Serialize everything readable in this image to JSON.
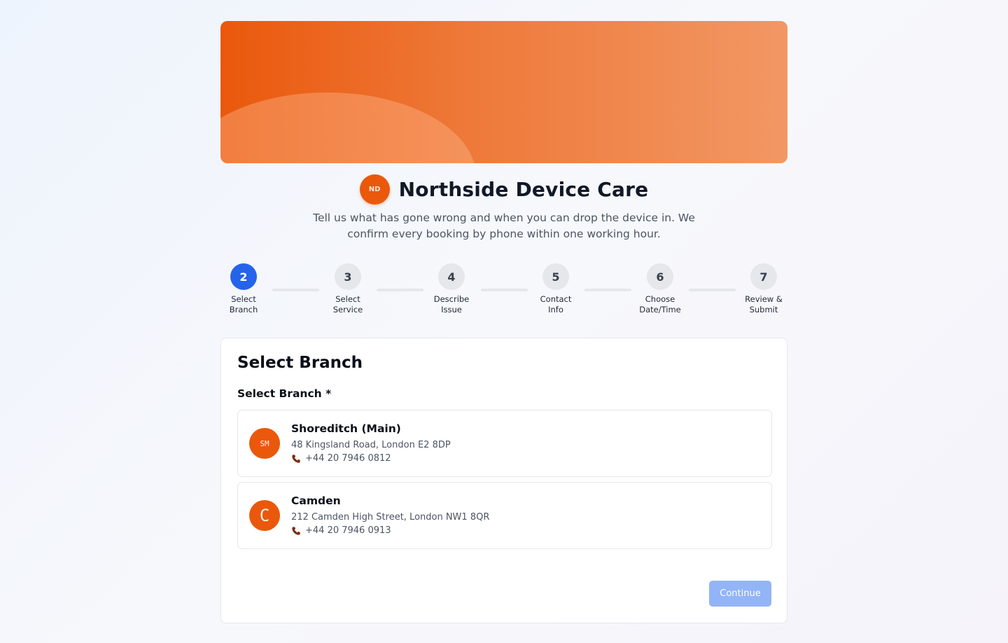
{
  "colors": {
    "brand_orange": "#ea580c",
    "active_blue": "#2563eb",
    "button_disabled": "#93b4f6"
  },
  "header": {
    "logo_text": "ND",
    "title": "Northside Device Care",
    "subtitle": "Tell us what has gone wrong and when you can drop the device in. We confirm every booking by phone within one working hour."
  },
  "stepper": {
    "active_step": "2",
    "steps": [
      {
        "number": "2",
        "line1": "Select",
        "line2": "Branch"
      },
      {
        "number": "3",
        "line1": "Select",
        "line2": "Service"
      },
      {
        "number": "4",
        "line1": "Describe",
        "line2": "Issue"
      },
      {
        "number": "5",
        "line1": "Contact",
        "line2": "Info"
      },
      {
        "number": "6",
        "line1": "Choose",
        "line2": "Date/Time"
      },
      {
        "number": "7",
        "line1": "Review &",
        "line2": "Submit"
      }
    ]
  },
  "form": {
    "card_title": "Select Branch",
    "field_label": "Select Branch *",
    "branches": [
      {
        "initials": "SM",
        "name": "Shoreditch (Main)",
        "address": "48 Kingsland Road, London E2 8DP",
        "phone": "+44 20 7946 0812",
        "icon": "phone-icon"
      },
      {
        "initials": "C",
        "name": "Camden",
        "address": "212 Camden High Street, London NW1 8QR",
        "phone": "+44 20 7946 0913",
        "icon": "phone-icon"
      }
    ],
    "continue_label": "Continue",
    "continue_disabled": true
  }
}
